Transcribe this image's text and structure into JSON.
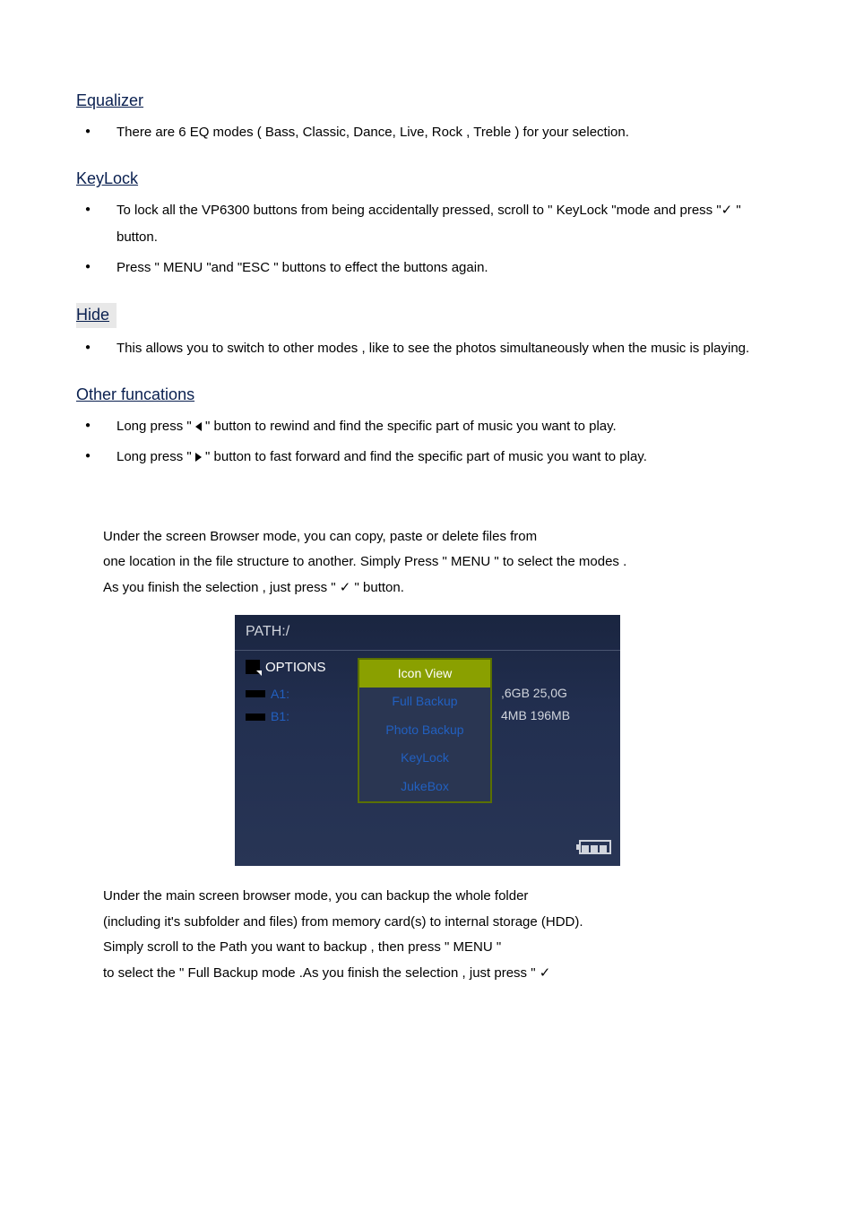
{
  "sections": {
    "equalizer": {
      "title": "Equalizer",
      "items": [
        {
          "text": "There are 6 EQ modes ( Bass, Classic, Dance, Live, Rock , Treble ) for your selection."
        }
      ]
    },
    "keylock": {
      "title": "KeyLock",
      "items": [
        {
          "prefix": "To lock all the VP6300 buttons from being accidentally pressed, scroll to \" KeyLock \"mode and press    \"",
          "check": "✓",
          "suffix": " \" button."
        },
        {
          "text": "Press \" MENU \"and \"ESC \" buttons to effect the buttons again."
        }
      ]
    },
    "hide": {
      "title": "Hide",
      "items": [
        {
          "text": "This allows you to switch to other modes , like to see the photos simultaneously when the music is playing."
        }
      ]
    },
    "other": {
      "title": "Other funcations",
      "items": [
        {
          "prefix": "Long press \" ",
          "icon": "left",
          "suffix": "    \" button to rewind and find the specific part of music you want to play."
        },
        {
          "prefix": "Long press \"  ",
          "icon": "right",
          "suffix": "  \" button to fast forward and find the specific part of music you want to play."
        }
      ]
    }
  },
  "para1": {
    "line1": "Under the screen Browser mode, you can copy, paste or delete files from",
    "line2": "one location in the file structure to another. Simply Press \" MENU \" to select the modes .",
    "line3_prefix": "As you finish the selection , just press \" ",
    "line3_check": "✓",
    "line3_suffix": "    \" button."
  },
  "screen": {
    "path": "PATH:/",
    "options_label": "OPTIONS",
    "left_items": [
      "A1:",
      "B1:"
    ],
    "menu": [
      "Icon View",
      "Full Backup",
      "Photo Backup",
      "KeyLock",
      "JukeBox"
    ],
    "right_items": [
      ",6GB 25,0G",
      "4MB 196MB"
    ]
  },
  "para2": {
    "line1": "Under the main screen browser mode, you can backup the whole folder",
    "line2": "(including it's subfolder and files) from memory card(s) to internal storage (HDD).",
    "line3": "Simply scroll to the Path you want to backup , then press \" MENU \"",
    "line4_prefix": "to select the \" Full Backup mode .As you finish the selection , just press \"    ",
    "line4_check": "✓"
  }
}
